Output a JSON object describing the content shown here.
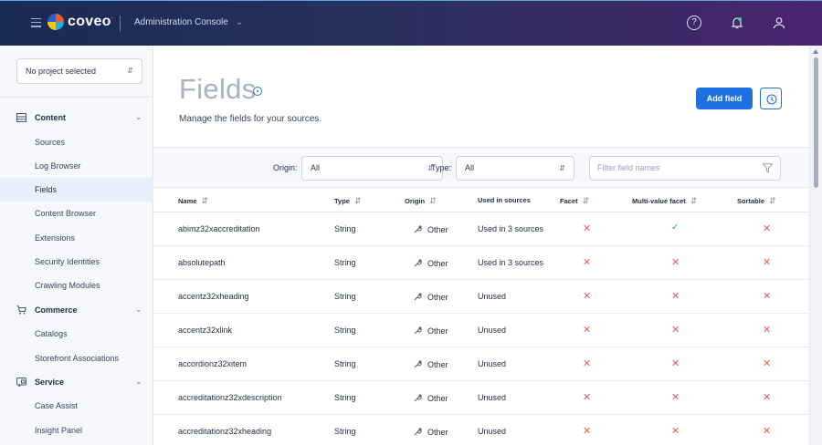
{
  "header": {
    "brand": "coveo",
    "brand_mark": "·",
    "console_label": "Administration Console",
    "icons": [
      "menu-icon",
      "help-icon",
      "notification-bell-icon",
      "user-icon"
    ]
  },
  "sidebar": {
    "project_select": "No project selected",
    "sections": [
      {
        "label": "Content",
        "icon": "content-icon"
      },
      {
        "label": "Commerce",
        "icon": "cart-icon"
      },
      {
        "label": "Service",
        "icon": "service-icon"
      }
    ],
    "items": [
      {
        "label": "Sources"
      },
      {
        "label": "Log Browser"
      },
      {
        "label": "Fields"
      },
      {
        "label": "Content Browser"
      },
      {
        "label": "Extensions"
      },
      {
        "label": "Security Identities"
      },
      {
        "label": "Crawling Modules"
      },
      {
        "label": "Catalogs"
      },
      {
        "label": "Storefront Associations"
      },
      {
        "label": "Case Assist"
      },
      {
        "label": "Insight Panel"
      }
    ],
    "active_item": "Fields"
  },
  "main": {
    "title": "Fields",
    "subtitle": "Manage the fields for your sources.",
    "add_button": "Add field",
    "filters": {
      "origin_label": "Origin:",
      "origin_value": "All",
      "type_label": "Type:",
      "type_value": "All",
      "search_placeholder": "Filter field names"
    },
    "columns": [
      "Name",
      "Type",
      "Origin",
      "Used in sources",
      "Facet",
      "Multi-value facet",
      "Sortable"
    ],
    "rows": [
      {
        "name": "abimz32xaccreditation",
        "type": "String",
        "origin": "Other",
        "used": "Used in 3 sources",
        "facet": false,
        "multi": true,
        "sortable": false
      },
      {
        "name": "absolutepath",
        "type": "String",
        "origin": "Other",
        "used": "Used in 3 sources",
        "facet": false,
        "multi": false,
        "sortable": false
      },
      {
        "name": "accentz32xheading",
        "type": "String",
        "origin": "Other",
        "used": "Unused",
        "facet": false,
        "multi": false,
        "sortable": false
      },
      {
        "name": "accentz32xlink",
        "type": "String",
        "origin": "Other",
        "used": "Unused",
        "facet": false,
        "multi": false,
        "sortable": false
      },
      {
        "name": "accordionz32xitem",
        "type": "String",
        "origin": "Other",
        "used": "Unused",
        "facet": false,
        "multi": false,
        "sortable": false
      },
      {
        "name": "accreditationz32xdescription",
        "type": "String",
        "origin": "Other",
        "used": "Unused",
        "facet": false,
        "multi": false,
        "sortable": false
      },
      {
        "name": "accreditationz32xheading",
        "type": "String",
        "origin": "Other",
        "used": "Unused",
        "facet": false,
        "multi": false,
        "sortable": false
      }
    ]
  },
  "colors": {
    "primary": "#1f6fe0",
    "active_nav": "#e6f1fb",
    "cross": "#e85a5a",
    "check": "#2bb37a"
  }
}
